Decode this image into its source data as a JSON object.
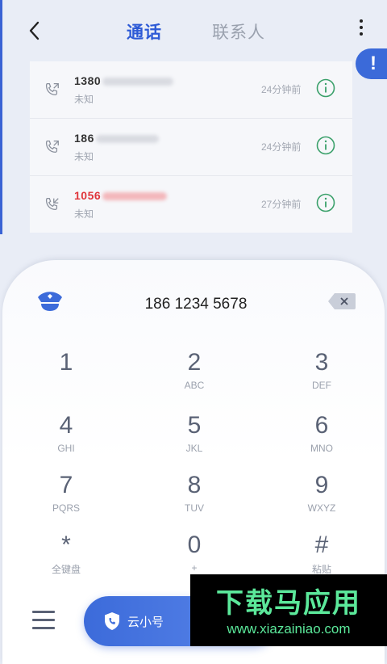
{
  "header": {
    "tab_calls": "通话",
    "tab_contacts": "联系人"
  },
  "alert_badge": "!",
  "call_log": [
    {
      "number": "1380",
      "location": "未知",
      "time": "24分钟前",
      "missed": false
    },
    {
      "number": "186",
      "location": "未知",
      "time": "24分钟前",
      "missed": false
    },
    {
      "number": "1056",
      "location": "未知",
      "time": "27分钟前",
      "missed": true
    }
  ],
  "dialer": {
    "number": "186 1234 5678",
    "keys": [
      {
        "digit": "1",
        "letters": ""
      },
      {
        "digit": "2",
        "letters": "ABC"
      },
      {
        "digit": "3",
        "letters": "DEF"
      },
      {
        "digit": "4",
        "letters": "GHI"
      },
      {
        "digit": "5",
        "letters": "JKL"
      },
      {
        "digit": "6",
        "letters": "MNO"
      },
      {
        "digit": "7",
        "letters": "PQRS"
      },
      {
        "digit": "8",
        "letters": "TUV"
      },
      {
        "digit": "9",
        "letters": "WXYZ"
      },
      {
        "digit": "*",
        "letters": "全键盘"
      },
      {
        "digit": "0",
        "letters": "+"
      },
      {
        "digit": "#",
        "letters": "粘贴"
      }
    ]
  },
  "bottom": {
    "call_button": "云小号"
  },
  "watermark": {
    "cn": "下载马应用",
    "en": "www.xiazainiao.com"
  },
  "colors": {
    "accent": "#2d5ad6",
    "missed": "#e0353b",
    "info_icon": "#3aa06a"
  }
}
